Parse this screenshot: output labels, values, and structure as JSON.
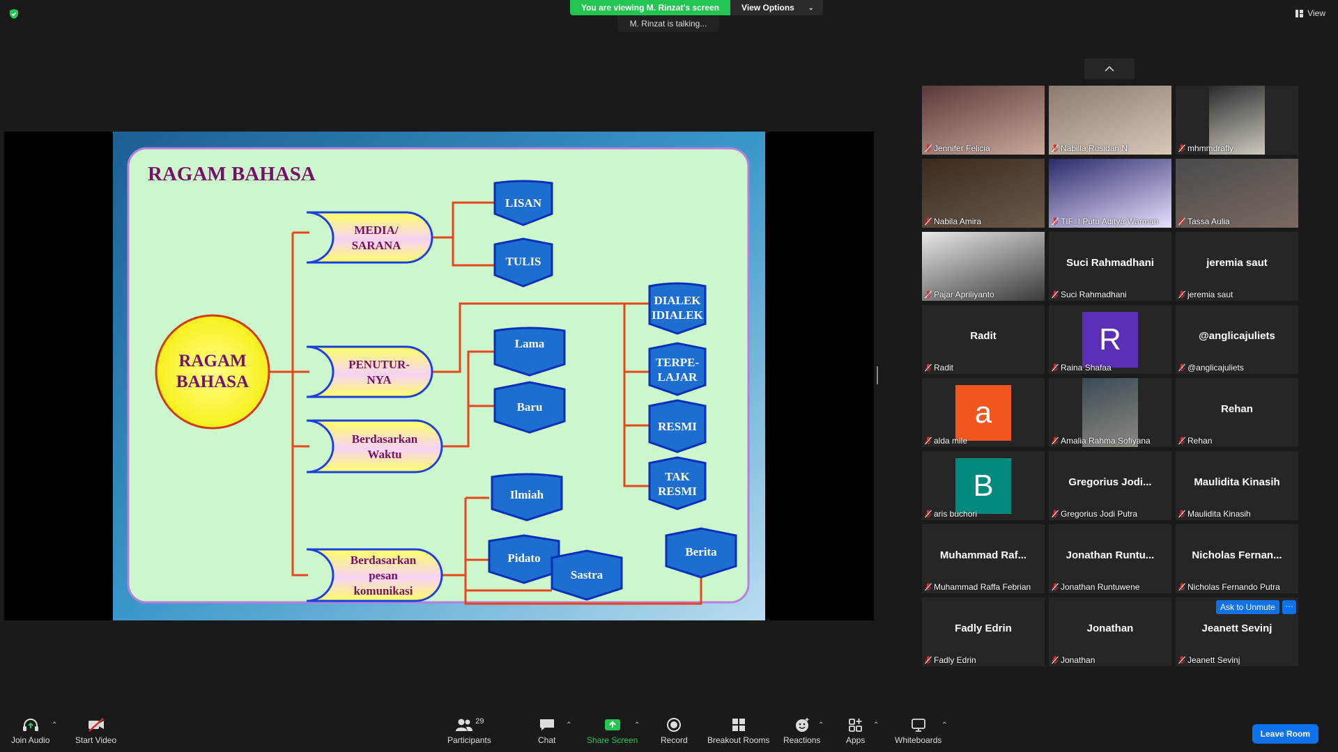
{
  "banner": {
    "viewing": "You are viewing M. Rinzat's screen",
    "view_options": "View Options"
  },
  "talking": "M. Rinzat is talking...",
  "view_label": "View",
  "slide": {
    "title": "RAGAM BAHASA",
    "center": [
      "RAGAM",
      "BAHASA"
    ],
    "categories": [
      {
        "lines": [
          "MEDIA/",
          "SARANA"
        ]
      },
      {
        "lines": [
          "PENUTUR-",
          "NYA"
        ]
      },
      {
        "lines": [
          "Berdasarkan",
          "Waktu"
        ]
      },
      {
        "lines": [
          "Berdasarkan",
          "pesan",
          "komunikasi"
        ]
      }
    ],
    "media_items": [
      "LISAN",
      "TULIS"
    ],
    "penutur_items": [
      [
        "DIALEK",
        "IDIALEK"
      ],
      [
        "TERPE-",
        "LAJAR"
      ],
      [
        "RESMI"
      ],
      [
        "TAK",
        "RESMI"
      ]
    ],
    "waktu_items": [
      "Lama",
      "Baru"
    ],
    "pesan_items": [
      "Ilmiah",
      "Pidato",
      "Sastra",
      "Berita"
    ]
  },
  "participants": [
    {
      "name": "Jennifer Felicia",
      "type": "video"
    },
    {
      "name": "Nabilla Rosidan N",
      "type": "video"
    },
    {
      "name": "mhmmdrafly",
      "type": "video"
    },
    {
      "name": "Nabila Amira",
      "type": "video"
    },
    {
      "name": "TIF_I Putu Aditya Warman",
      "type": "video"
    },
    {
      "name": "Tassa Aulia",
      "type": "video"
    },
    {
      "name": "Pajar Apriliyanto",
      "type": "video"
    },
    {
      "name": "Suci Rahmadhani",
      "display": "Suci Rahmadhani",
      "type": "name"
    },
    {
      "name": "jeremia saut",
      "display": "jeremia saut",
      "type": "name"
    },
    {
      "name": "Radit",
      "display": "Radit",
      "type": "name"
    },
    {
      "name": "Raina Shafaa",
      "avatar": "R",
      "avatar_color": "#5b2fb5",
      "type": "avatar"
    },
    {
      "name": "@anglicajuliets",
      "display": "@anglicajuliets",
      "type": "name"
    },
    {
      "name": "alda mile",
      "avatar": "a",
      "avatar_color": "#f1561f",
      "type": "avatar"
    },
    {
      "name": "Amalia Rahma Sofiyana",
      "type": "video"
    },
    {
      "name": "Rehan",
      "display": "Rehan",
      "type": "name"
    },
    {
      "name": "aris buchori",
      "avatar": "B",
      "avatar_color": "#008a7c",
      "type": "avatar"
    },
    {
      "name": "Gregorius Jodi Putra",
      "display": "Gregorius  Jodi...",
      "type": "name"
    },
    {
      "name": "Maulidita Kinasih",
      "display": "Maulidita Kinasih",
      "type": "name"
    },
    {
      "name": "Muhammad Raffa Febrian",
      "display": "Muhammad  Raf...",
      "type": "name"
    },
    {
      "name": "Jonathan Runtuwene",
      "display": "Jonathan  Runtu...",
      "type": "name"
    },
    {
      "name": "Nicholas Fernando Putra",
      "display": "Nicholas  Fernan...",
      "type": "name"
    },
    {
      "name": "Fadly Edrin",
      "display": "Fadly Edrin",
      "type": "name"
    },
    {
      "name": "Jonathan",
      "display": "Jonathan",
      "type": "name"
    },
    {
      "name": "Jeanett Sevinj",
      "display": "Jeanett Sevinj",
      "type": "name"
    }
  ],
  "ask_to_unmute": "Ask to Unmute",
  "more": "···",
  "toolbar": {
    "join_audio": "Join Audio",
    "start_video": "Start Video",
    "participants": "Participants",
    "participants_count": "29",
    "chat": "Chat",
    "share_screen": "Share Screen",
    "record": "Record",
    "breakout": "Breakout Rooms",
    "reactions": "Reactions",
    "apps": "Apps",
    "whiteboards": "Whiteboards",
    "leave": "Leave Room"
  },
  "colors": {
    "accent": "#0e72ed",
    "share_green": "#23c552",
    "slide_bg": "#ccf7cc",
    "title": "#7a0e6b",
    "shape_blue": "#1c6fd1",
    "line": "#e8461a"
  }
}
